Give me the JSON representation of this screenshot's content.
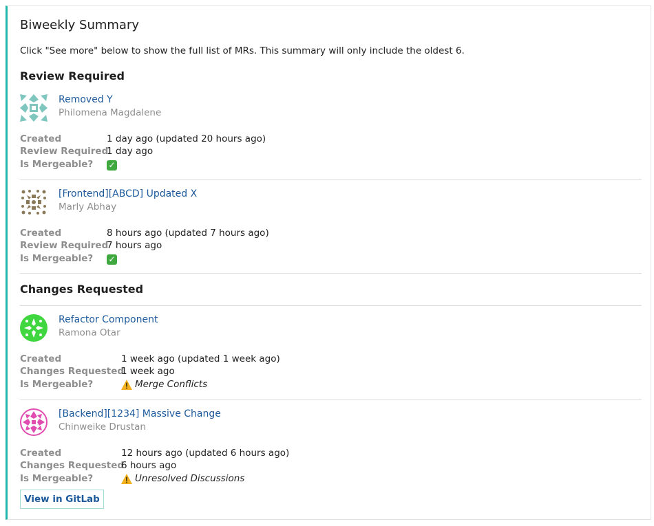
{
  "summary": {
    "title": "Biweekly Summary",
    "intro": "Click \"See more\" below to show the full list of MRs. This summary will only include the oldest 6."
  },
  "review_required": {
    "heading": "Review Required",
    "items": [
      {
        "title": "Removed Y",
        "author": "Philomena Magdalene",
        "created_label": "Created",
        "created_value": "1 day ago (updated 20 hours ago)",
        "status_label": "Review Required",
        "status_value": "1 day ago",
        "mergeable_label": "Is Mergeable?",
        "avatar_color": "#7fc6bf"
      },
      {
        "title": "[Frontend][ABCD] Updated X",
        "author": "Marly Abhay",
        "created_label": "Created",
        "created_value": "8 hours ago (updated 7 hours ago)",
        "status_label": "Review Required",
        "status_value": "7 hours ago",
        "mergeable_label": "Is Mergeable?",
        "avatar_color": "#8a7a5a"
      }
    ]
  },
  "changes_requested": {
    "heading": "Changes Requested",
    "items": [
      {
        "title": "Refactor Component",
        "author": "Ramona Otar",
        "created_label": "Created",
        "created_value": "1 week ago (updated 1 week ago)",
        "status_label": "Changes Requested",
        "status_value": "1 week ago",
        "mergeable_label": "Is Mergeable?",
        "mergeable_value": "Merge Conflicts",
        "avatar_color": "#3fd63f"
      },
      {
        "title": "[Backend][1234] Massive Change",
        "author": "Chinweike Drustan",
        "created_label": "Created",
        "created_value": "12 hours ago (updated 6 hours ago)",
        "status_label": "Changes Requested",
        "status_value": "6 hours ago",
        "mergeable_label": "Is Mergeable?",
        "mergeable_value": "Unresolved Discussions",
        "avatar_color": "#e04cb0"
      }
    ]
  },
  "actions": {
    "view_button": "View in GitLab"
  },
  "icons": {
    "check": "check-mark-icon",
    "warning": "warning-icon"
  },
  "colors": {
    "accent": "#1fb5a8",
    "link": "#1d5a9c",
    "muted": "#8e8e8e"
  }
}
